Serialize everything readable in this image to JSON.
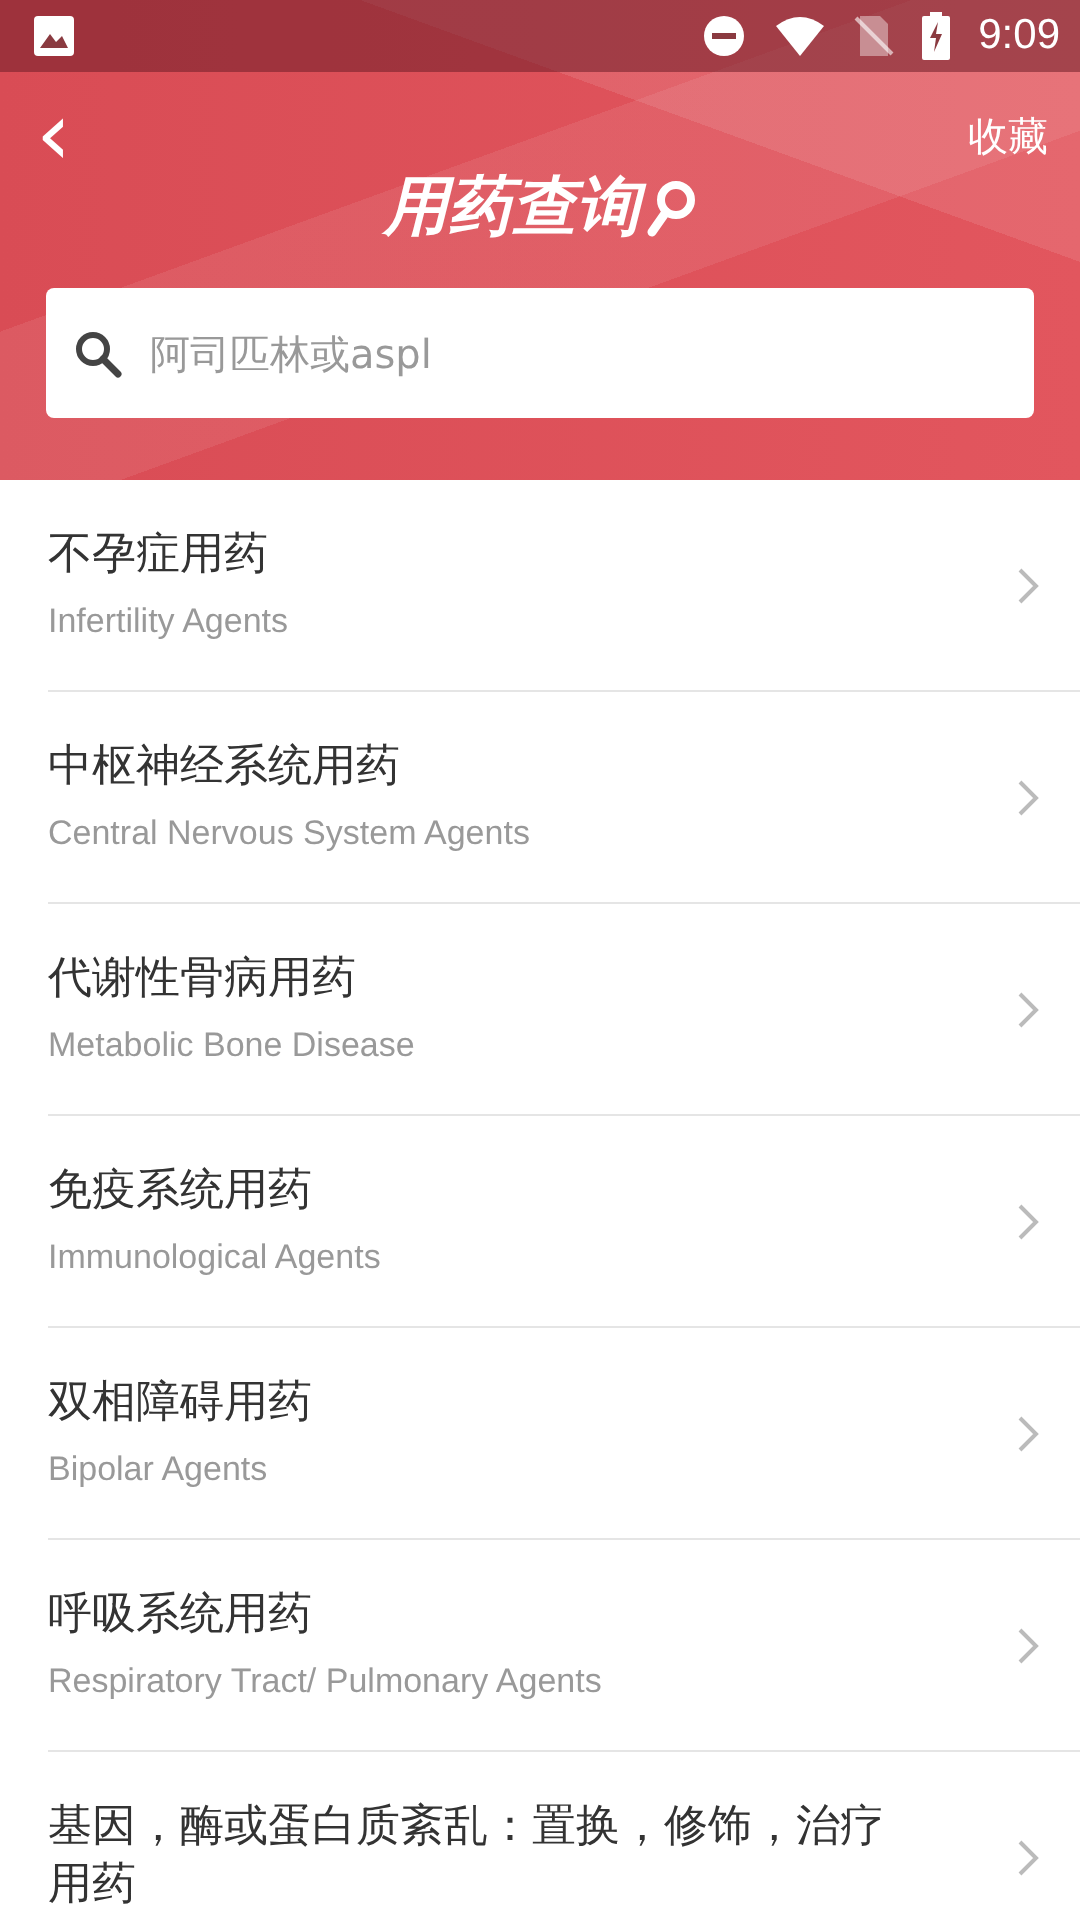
{
  "status_bar": {
    "time": "9:09"
  },
  "header": {
    "back": "‹",
    "action": "收藏",
    "title": "用药查询"
  },
  "search": {
    "placeholder": "阿司匹林或aspl"
  },
  "categories": [
    {
      "name": "不孕症用药",
      "english": "Infertility Agents"
    },
    {
      "name": "中枢神经系统用药",
      "english": "Central Nervous System Agents"
    },
    {
      "name": "代谢性骨病用药",
      "english": "Metabolic Bone Disease"
    },
    {
      "name": "免疫系统用药",
      "english": "Immunological Agents"
    },
    {
      "name": "双相障碍用药",
      "english": "Bipolar Agents"
    },
    {
      "name": "呼吸系统用药",
      "english": "Respiratory Tract/ Pulmonary Agents"
    },
    {
      "name": "基因，酶或蛋白质紊乱：置换，修饰，治疗用药"
    }
  ]
}
